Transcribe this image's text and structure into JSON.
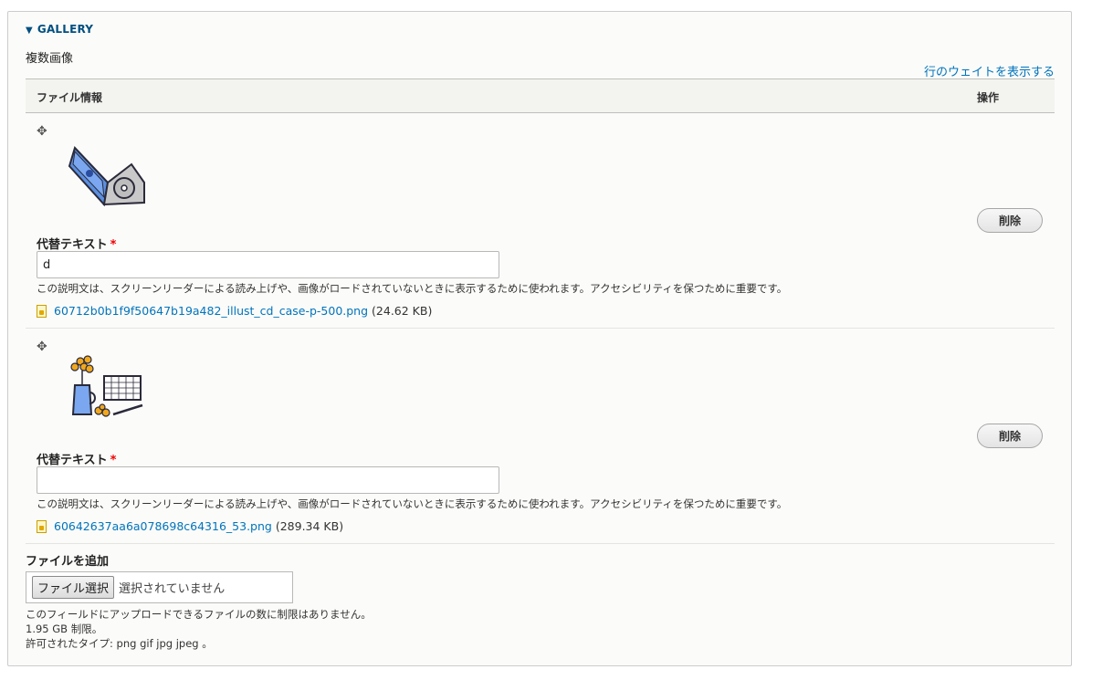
{
  "fieldset": {
    "legend": "GALLERY",
    "field_label": "複数画像",
    "weights_link": "行のウェイトを表示する"
  },
  "table": {
    "headers": {
      "file_info": "ファイル情報",
      "operations": "操作"
    },
    "rows": [
      {
        "thumbnail_icon": "cd-case-illustration",
        "alt_label": "代替テキスト",
        "alt_required": "*",
        "alt_value": "d",
        "alt_help": "この説明文は、スクリーンリーダーによる読み上げや、画像がロードされていないときに表示するために使われます。アクセシビリティを保つために重要です。",
        "file_name": "60712b0b1f9f50647b19a482_illust_cd_case-p-500.png",
        "file_size": "(24.62 KB)",
        "delete_label": "削除"
      },
      {
        "thumbnail_icon": "flower-vase-calendar-illustration",
        "alt_label": "代替テキスト",
        "alt_required": "*",
        "alt_value": "",
        "alt_help": "この説明文は、スクリーンリーダーによる読み上げや、画像がロードされていないときに表示するために使われます。アクセシビリティを保つために重要です。",
        "file_name": "60642637aa6a078698c64316_53.png",
        "file_size": "(289.34 KB)",
        "delete_label": "削除"
      }
    ]
  },
  "add_file": {
    "label": "ファイルを追加",
    "choose_button": "ファイル選択",
    "no_file_text": "選択されていません",
    "help": [
      "このフィールドにアップロードできるファイルの数に制限はありません。",
      "1.95 GB 制限。",
      "許可されたタイプ: png gif jpg jpeg 。"
    ]
  },
  "colors": {
    "link": "#0074bd",
    "legend": "#004f80",
    "required": "#ee0000"
  }
}
